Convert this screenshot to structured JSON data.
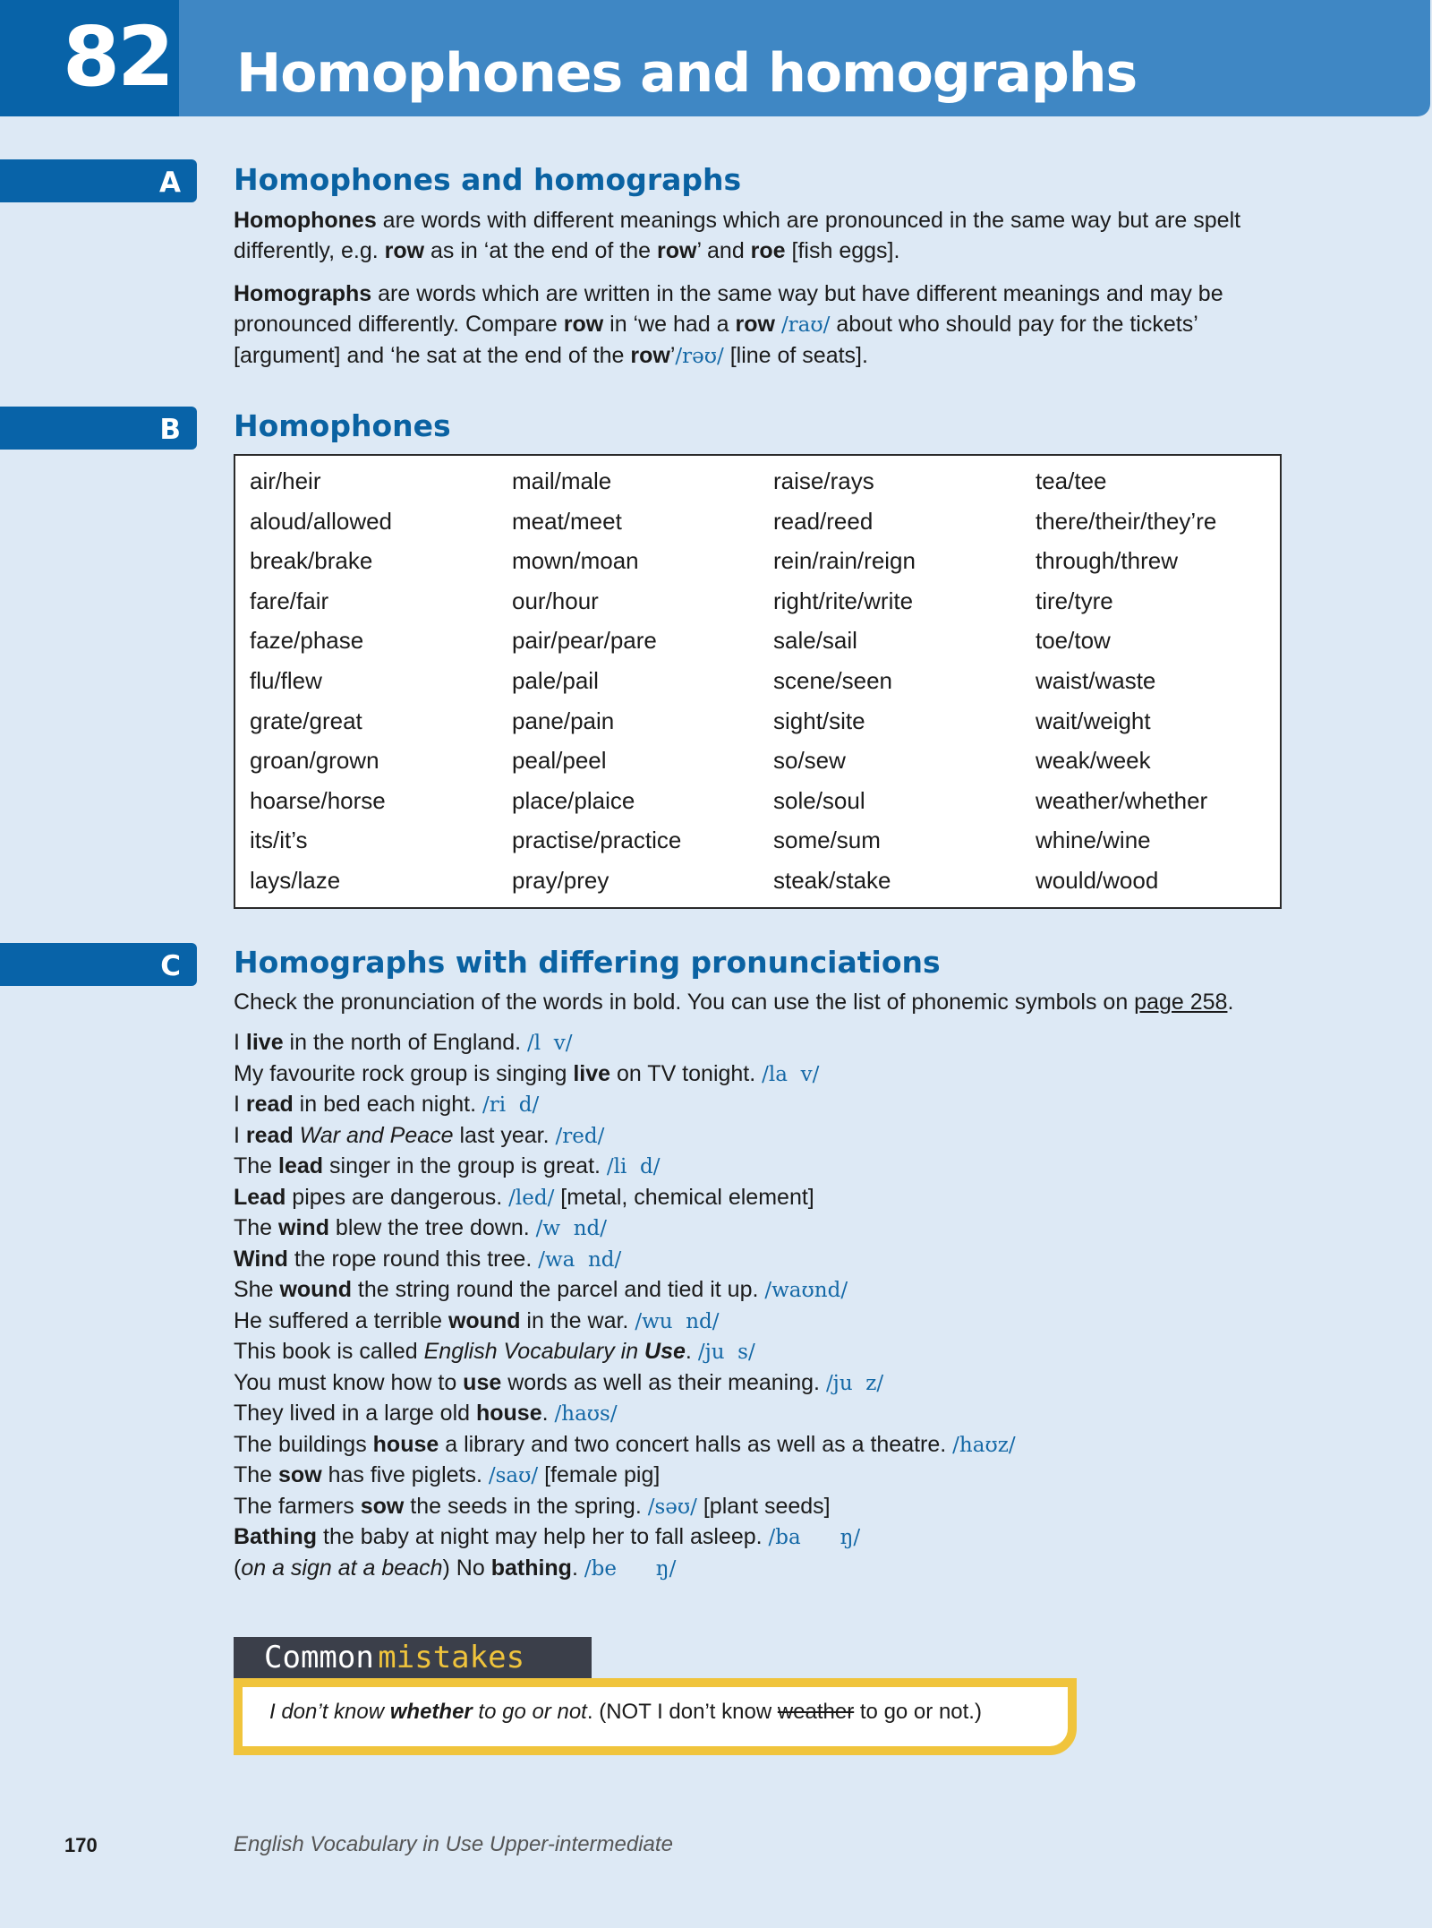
{
  "header": {
    "unit_number": "82",
    "title": "Homophones and homographs"
  },
  "section_a": {
    "tab": "A",
    "heading": "Homophones and homographs",
    "p1": {
      "t1": "Homophones",
      "t2": " are words with different meanings which are pronounced in the same way but are spelt differently, e.g. ",
      "t3": "row",
      "t4": " as in ‘at the end of the ",
      "t5": "row",
      "t6": "’ and ",
      "t7": "roe",
      "t8": " [fish eggs]."
    },
    "p2": {
      "t1": "Homographs",
      "t2": " are words which are written in the same way but have different meanings and may be pronounced differently. Compare ",
      "t3": "row",
      "t4": " in ‘we had a ",
      "t5": "row",
      "t6": " ",
      "ipa1": "/raʊ/",
      "t7": " about who should pay for the tickets’ [argument] and ‘he sat at the end of the ",
      "t8": "row",
      "t9": "’",
      "ipa2": "/rəʊ/",
      "t10": " [line of seats]."
    }
  },
  "section_b": {
    "tab": "B",
    "heading": "Homophones",
    "columns": [
      [
        "air/heir",
        "aloud/allowed",
        "break/brake",
        "fare/fair",
        "faze/phase",
        "flu/flew",
        "grate/great",
        "groan/grown",
        "hoarse/horse",
        "its/it’s",
        "lays/laze"
      ],
      [
        "mail/male",
        "meat/meet",
        "mown/moan",
        "our/hour",
        "pair/pear/pare",
        "pale/pail",
        "pane/pain",
        "peal/peel",
        "place/plaice",
        "practise/practice",
        "pray/prey"
      ],
      [
        "raise/rays",
        "read/reed",
        "rein/rain/reign",
        "right/rite/write",
        "sale/sail",
        "scene/seen",
        "sight/site",
        "so/sew",
        "sole/soul",
        "some/sum",
        "steak/stake"
      ],
      [
        "tea/tee",
        "there/their/they’re",
        "through/threw",
        "tire/tyre",
        "toe/tow",
        "waist/waste",
        "wait/weight",
        "weak/week",
        "weather/whether",
        "whine/wine",
        "would/wood"
      ]
    ]
  },
  "section_c": {
    "tab": "C",
    "heading": "Homographs with differing pronunciations",
    "intro": "Check the pronunciation of the words in bold. You can use the list of phonemic symbols on ",
    "intro_link": "page 258",
    "intro_end": ".",
    "sentences": [
      {
        "a": "I ",
        "b": "live",
        "c": " in the north of England. ",
        "ipa": "/l  v/",
        "d": ""
      },
      {
        "a": "My favourite rock group is singing ",
        "b": "live",
        "c": " on TV tonight. ",
        "ipa": "/la  v/",
        "d": ""
      },
      {
        "a": "I ",
        "b": "read",
        "c": " in bed each night. ",
        "ipa": "/ri  d/",
        "d": ""
      },
      {
        "a": "I ",
        "b": "read",
        "c": " ",
        "i": "War and Peace",
        "c2": " last year. ",
        "ipa": "/red/",
        "d": ""
      },
      {
        "a": "The ",
        "b": "lead",
        "c": " singer in the group is great. ",
        "ipa": "/li  d/",
        "d": ""
      },
      {
        "a": "",
        "b": "Lead",
        "c": " pipes are dangerous. ",
        "ipa": "/led/",
        "d": " [metal, chemical element]"
      },
      {
        "a": "The ",
        "b": "wind",
        "c": " blew the tree down. ",
        "ipa": "/w  nd/",
        "d": ""
      },
      {
        "a": "",
        "b": "Wind",
        "c": " the rope round this tree. ",
        "ipa": "/wa  nd/",
        "d": ""
      },
      {
        "a": "She ",
        "b": "wound",
        "c": " the string round the parcel and tied it up. ",
        "ipa": "/waʊnd/",
        "d": ""
      },
      {
        "a": "He suffered a terrible ",
        "b": "wound",
        "c": " in the war. ",
        "ipa": "/wu  nd/",
        "d": ""
      },
      {
        "a": "This book is called ",
        "i": "English Vocabulary in ",
        "bi": "Use",
        "c": ". ",
        "ipa": "/ju  s/",
        "d": ""
      },
      {
        "a": "You must know how to ",
        "b": "use",
        "c": " words as well as their meaning. ",
        "ipa": "/ju  z/",
        "d": ""
      },
      {
        "a": "They lived in a large old ",
        "b": "house",
        "c": ". ",
        "ipa": "/haʊs/",
        "d": ""
      },
      {
        "a": "The buildings ",
        "b": "house",
        "c": " a library and two concert halls as well as a theatre. ",
        "ipa": "/haʊz/",
        "d": ""
      },
      {
        "a": "The ",
        "b": "sow",
        "c": " has five piglets. ",
        "ipa": "/saʊ/",
        "d": " [female pig]"
      },
      {
        "a": "The farmers ",
        "b": "sow",
        "c": " the seeds in the spring. ",
        "ipa": "/səʊ/",
        "d": " [plant seeds]"
      },
      {
        "a": "",
        "b": "Bathing",
        "c": " the baby at night may help her to fall asleep. ",
        "ipa": "/ba      ŋ/",
        "d": ""
      },
      {
        "a": "(",
        "i": "on a sign at a beach",
        "c": ") No ",
        "b2": "bathing",
        "c2": ". ",
        "ipa": "/be      ŋ/",
        "d": ""
      }
    ]
  },
  "common_mistakes": {
    "label1": "Common",
    "label2": "mistakes",
    "text": {
      "i1": "I don’t know ",
      "bi": "whether",
      "i2": " to go or not",
      "t1": ". (NOT I don’t know ",
      "s": "weather",
      "t2": " to go or not.)"
    }
  },
  "footer": {
    "page_number": "170",
    "book_title": "English Vocabulary in Use Upper-intermediate"
  },
  "colors": {
    "header_band": "#3f87c4",
    "unit_box": "#0863a8",
    "heading": "#0a62a2",
    "ipa": "#1468a6",
    "mistakes_border": "#f0c43c",
    "page_bg": "#dde9f5"
  }
}
